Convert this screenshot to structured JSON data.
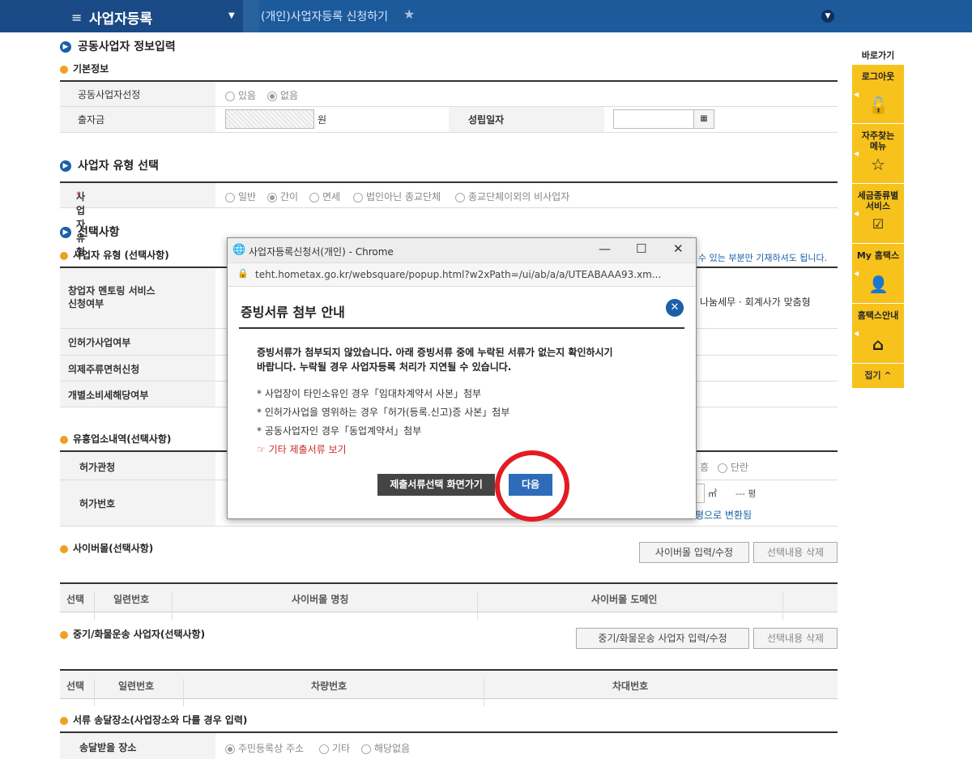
{
  "topbar": {
    "menu_title": "사업자등록",
    "breadcrumb": "(개인)사업자등록 신청하기"
  },
  "joint": {
    "section_title": "공동사업자 정보입력",
    "basic_title": "기본정보",
    "select_label": "공동사업자선정",
    "opt_yes": "있음",
    "opt_no": "없음",
    "capital_label": "출자금",
    "capital_unit": "원",
    "founded_label": "성립일자"
  },
  "biztype": {
    "section_title": "사업자 유형 선택",
    "required_mark": "*",
    "label": "사업자 유형",
    "options": [
      "일반",
      "간이",
      "면세",
      "법인아닌 종교단체",
      "종교단체이외의 비사업자"
    ]
  },
  "optional": {
    "section_title": "선택사항",
    "sub_title": "사업자 유형 (선택사항)",
    "note_fragment": "수 있는 부분만 기재하셔도 됩니다.",
    "mentor_label_1": "창업자 멘토링 서비스",
    "mentor_label_2": "신청여부",
    "mentor_fragment": "나눔세무 · 회계사가 맞춤형",
    "license_label": "인허가사업여부",
    "liquor_label": "의제주류면허신청",
    "excise_label": "개별소비세해당여부"
  },
  "entertain": {
    "sub_title": "유흥업소내역(선택사항)",
    "office_label": "허가관청",
    "number_label": "허가번호",
    "opt_frag_a": "흥",
    "opt_frag_b": "단란",
    "area_unit": "㎡",
    "pyeong_dash": "--- 평",
    "convert_link": "평으로 변환됨"
  },
  "cybermall": {
    "sub_title": "사이버몰(선택사항)",
    "btn_edit": "사이버몰 입력/수정",
    "btn_delete": "선택내용 삭제",
    "headers": [
      "선택",
      "일련번호",
      "사이버몰 명칭",
      "사이버몰 도메인"
    ]
  },
  "transport": {
    "sub_title": "중기/화물운송 사업자(선택사항)",
    "btn_edit": "중기/화물운송 사업자 입력/수정",
    "btn_delete": "선택내용 삭제",
    "headers": [
      "선택",
      "일련번호",
      "차량번호",
      "차대번호"
    ]
  },
  "delivery": {
    "sub_title": "서류 송달장소(사업장소와 다를 경우 입력)",
    "label": "송달받을 장소",
    "options": [
      "주민등록상 주소",
      "기타",
      "해당없음"
    ]
  },
  "quickmenu": {
    "header": "바로가기",
    "items": [
      "로그아웃",
      "자주찾는 메뉴",
      "세금종류별 서비스",
      "My 홈택스",
      "홈택스안내"
    ],
    "collapse": "접기 ^"
  },
  "popup": {
    "window_title": "사업자등록신청서(개인) - Chrome",
    "url": "teht.hometax.go.kr/websquare/popup.html?w2xPath=/ui/ab/a/a/UTEABAAA93.xm...",
    "dialog_title": "증빙서류 첨부 안내",
    "message_1": "증빙서류가 첨부되지 않았습니다. 아래 증빙서류 중에 누락된 서류가 없는지 확인하시기",
    "message_2": "바랍니다. 누락될 경우 사업자등록 처리가 지연될 수 있습니다.",
    "items": [
      "* 사업장이 타인소유인 경우「임대차계약서 사본」첨부",
      "* 인허가사업을 영위하는 경우「허가(등록.신고)증 사본」첨부",
      "* 공동사업자인 경우「동업계약서」첨부"
    ],
    "other_link": "기타 제출서류 보기",
    "btn_select": "제출서류선택 화면가기",
    "btn_next": "다음"
  }
}
